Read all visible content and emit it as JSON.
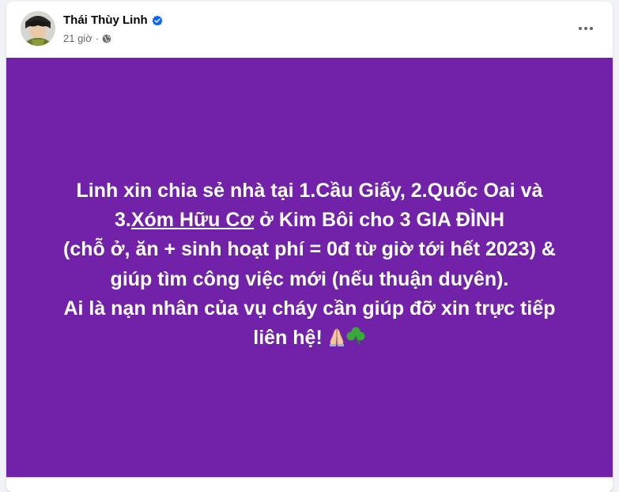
{
  "post": {
    "author": "Thái Thùy Linh",
    "time": "21 giờ",
    "separator": "·",
    "background_color": "#7122a8",
    "lines": {
      "l1": "Linh xin chia sẻ nhà tại 1.Cầu Giấy, 2.Quốc Oai và",
      "l2_prefix": "3.",
      "l2_link": "Xóm Hữu Cơ",
      "l2_suffix": " ở Kim Bôi cho 3 GIA ĐÌNH",
      "l3": "(chỗ ở, ăn + sinh hoạt phí = 0đ từ giờ tới hết 2023) &",
      "l4": "giúp tìm công việc mới (nếu thuận duyên).",
      "l5": "Ai là nạn nhân của vụ cháy cần giúp đỡ xin trực tiếp",
      "l6": "liên hệ!"
    },
    "icons": {
      "verified": "verified-badge-icon",
      "privacy": "globe-icon",
      "more": "more-options-icon",
      "emoji1": "folded-hands-icon",
      "emoji2": "shamrock-icon"
    },
    "colors": {
      "verified": "#0866ff",
      "text": "#ffffff"
    }
  }
}
